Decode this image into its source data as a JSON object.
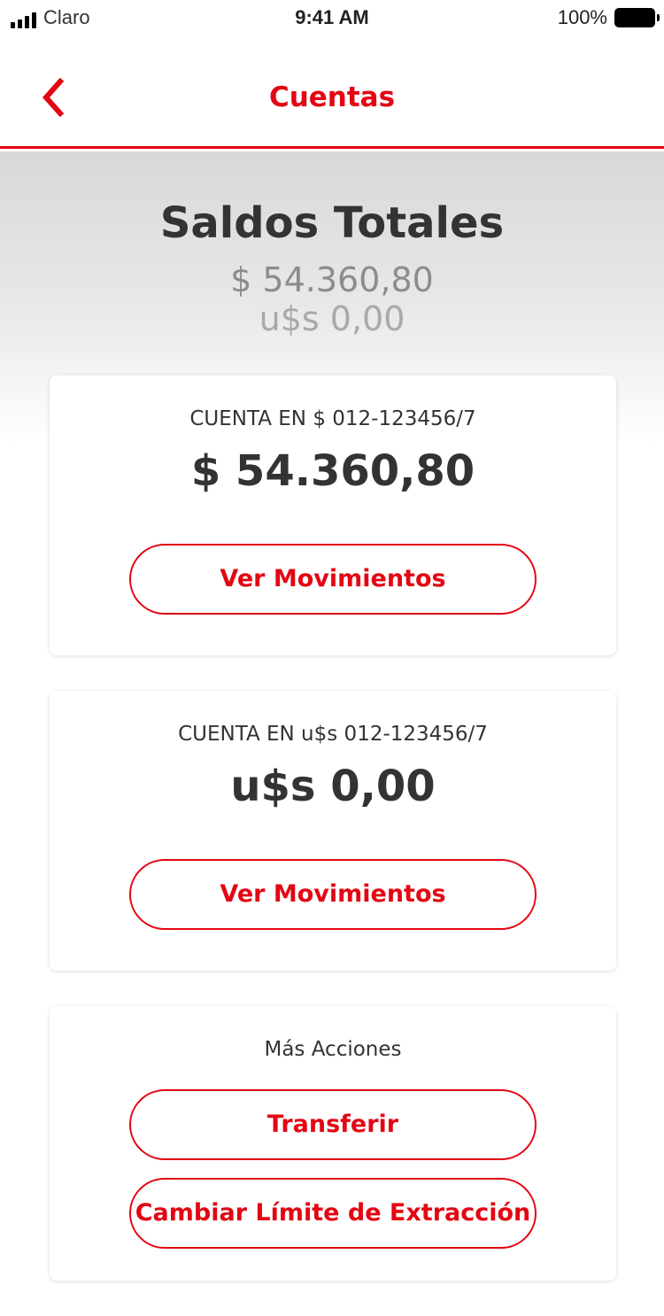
{
  "status_bar": {
    "carrier": "Claro",
    "time": "9:41 AM",
    "battery": "100%"
  },
  "nav": {
    "title": "Cuentas",
    "back_icon": "chevron-left-icon"
  },
  "summary": {
    "title": "Saldos Totales",
    "total_ars": "$ 54.360,80",
    "total_usd": "u$s 0,00"
  },
  "accounts": [
    {
      "label": "CUENTA EN $ 012-123456/7",
      "balance": "$ 54.360,80",
      "button_label": "Ver Movimientos"
    },
    {
      "label": "CUENTA EN u$s 012-123456/7",
      "balance": "u$s 0,00",
      "button_label": "Ver Movimientos"
    }
  ],
  "more_actions": {
    "title": "Más Acciones",
    "transfer_label": "Transferir",
    "change_limit_label": "Cambiar Límite de Extracción"
  },
  "colors": {
    "accent": "#e30613",
    "text_dark": "#333333",
    "text_muted": "#8c8c8c"
  }
}
